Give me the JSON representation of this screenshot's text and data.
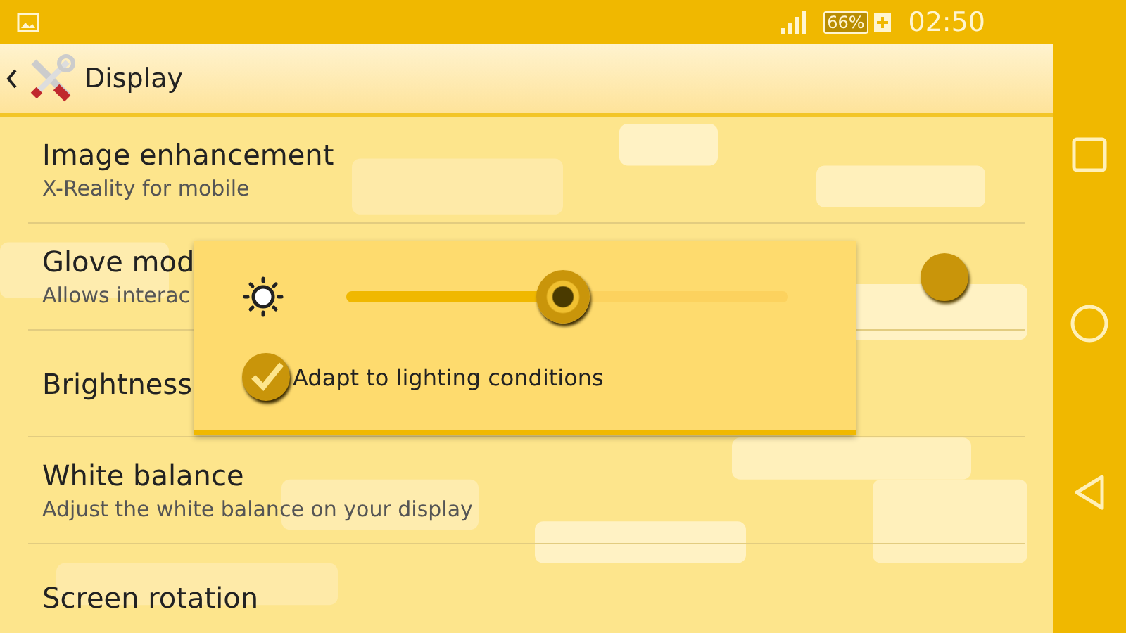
{
  "status_bar": {
    "battery": "66%",
    "charging": true,
    "time": "02:50"
  },
  "action_bar": {
    "title": "Display"
  },
  "settings": [
    {
      "title": "Image enhancement",
      "summary": "X-Reality for mobile"
    },
    {
      "title": "Glove mod",
      "summary": "Allows interac",
      "kind": "switch",
      "on": true
    },
    {
      "title": "Brightness"
    },
    {
      "title": "White balance",
      "summary": "Adjust the white balance on your display"
    },
    {
      "title": "Screen rotation"
    }
  ],
  "brightness_dialog": {
    "level": 0.49,
    "adaptive": {
      "label": "Adapt to lighting conditions",
      "checked": true
    }
  }
}
